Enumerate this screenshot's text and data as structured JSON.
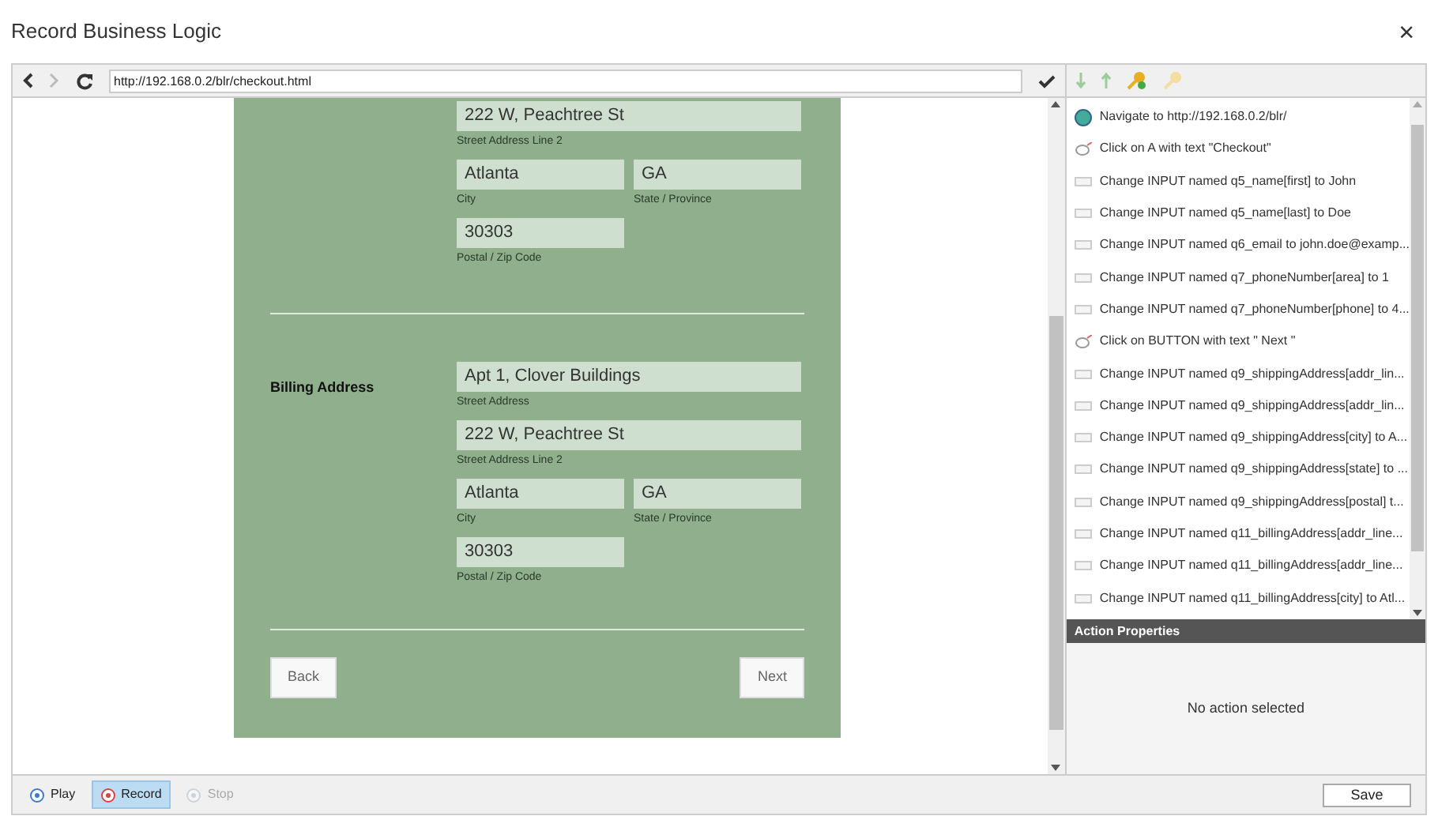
{
  "window": {
    "title": "Record Business Logic",
    "close": "×"
  },
  "browser": {
    "url": "http://192.168.0.2/blr/checkout.html",
    "form": {
      "sections": [
        {
          "rows": [
            [
              {
                "value": "222 W, Peachtree St",
                "label": "Street Address Line 2"
              }
            ],
            [
              {
                "value": "Atlanta",
                "label": "City"
              },
              {
                "value": "GA",
                "label": "State / Province"
              }
            ],
            [
              {
                "value": "30303",
                "label": "Postal / Zip Code"
              }
            ]
          ]
        },
        {
          "heading": "Billing Address",
          "rows": [
            [
              {
                "value": "Apt 1, Clover Buildings",
                "label": "Street Address"
              }
            ],
            [
              {
                "value": "222 W, Peachtree St",
                "label": "Street Address Line 2"
              }
            ],
            [
              {
                "value": "Atlanta",
                "label": "City"
              },
              {
                "value": "GA",
                "label": "State / Province"
              }
            ],
            [
              {
                "value": "30303",
                "label": "Postal / Zip Code"
              }
            ]
          ]
        }
      ],
      "back": "Back",
      "next": "Next"
    }
  },
  "actions": [
    {
      "kind": "navigate",
      "text": "Navigate to http://192.168.0.2/blr/"
    },
    {
      "kind": "click",
      "text": "Click on A with text \"Checkout\""
    },
    {
      "kind": "change",
      "text": "Change INPUT named q5_name[first] to John"
    },
    {
      "kind": "change",
      "text": "Change INPUT named q5_name[last] to Doe"
    },
    {
      "kind": "change",
      "text": "Change INPUT named q6_email to john.doe@examp..."
    },
    {
      "kind": "change",
      "text": "Change INPUT named q7_phoneNumber[area] to 1"
    },
    {
      "kind": "change",
      "text": "Change INPUT named q7_phoneNumber[phone] to 4..."
    },
    {
      "kind": "click",
      "text": "Click on BUTTON with text \" Next \""
    },
    {
      "kind": "change",
      "text": "Change INPUT named q9_shippingAddress[addr_lin..."
    },
    {
      "kind": "change",
      "text": "Change INPUT named q9_shippingAddress[addr_lin..."
    },
    {
      "kind": "change",
      "text": "Change INPUT named q9_shippingAddress[city] to A..."
    },
    {
      "kind": "change",
      "text": "Change INPUT named q9_shippingAddress[state] to ..."
    },
    {
      "kind": "change",
      "text": "Change INPUT named q9_shippingAddress[postal] t..."
    },
    {
      "kind": "change",
      "text": "Change INPUT named q11_billingAddress[addr_line..."
    },
    {
      "kind": "change",
      "text": "Change INPUT named q11_billingAddress[addr_line..."
    },
    {
      "kind": "change",
      "text": "Change INPUT named q11_billingAddress[city] to Atl..."
    }
  ],
  "properties": {
    "title": "Action Properties",
    "empty": "No action selected"
  },
  "controls": [
    {
      "kind": "play",
      "label": "Play",
      "selected": false,
      "disabled": false
    },
    {
      "kind": "record",
      "label": "Record",
      "selected": true,
      "disabled": false
    },
    {
      "kind": "stop",
      "label": "Stop",
      "selected": false,
      "disabled": true
    }
  ],
  "save": "Save"
}
